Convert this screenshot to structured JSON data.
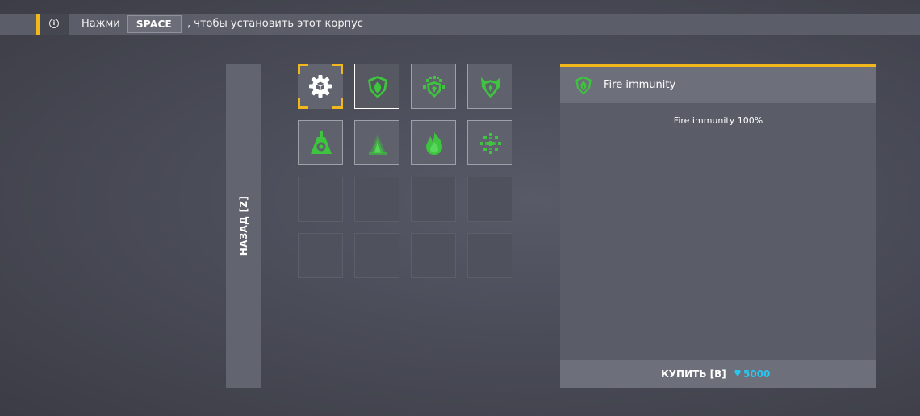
{
  "hint": {
    "prefix": "Нажми",
    "key": "SPACE",
    "suffix": ", чтобы установить этот корпус"
  },
  "back_button": {
    "label": "НАЗАД [Z]"
  },
  "grid": {
    "slots": [
      {
        "state": "selected",
        "icon": "gear-icon"
      },
      {
        "state": "hover",
        "icon": "shield-flame-icon"
      },
      {
        "state": "filled",
        "icon": "shield-snowflake-icon"
      },
      {
        "state": "filled",
        "icon": "shield-horns-icon"
      },
      {
        "state": "filled",
        "icon": "mine-icon"
      },
      {
        "state": "filled",
        "icon": "tesla-icon"
      },
      {
        "state": "filled",
        "icon": "flame-icon"
      },
      {
        "state": "filled",
        "icon": "snowflake-icon"
      },
      {
        "state": "empty"
      },
      {
        "state": "empty"
      },
      {
        "state": "empty"
      },
      {
        "state": "empty"
      },
      {
        "state": "empty"
      },
      {
        "state": "empty"
      },
      {
        "state": "empty"
      },
      {
        "state": "empty"
      }
    ]
  },
  "panel": {
    "title": "Fire immunity",
    "description": "Fire immunity 100%",
    "buy_label": "КУПИТЬ [B]",
    "price": "5000",
    "header_icon": "shield-flame-icon"
  },
  "colors": {
    "accent": "#f2b71c",
    "green": "#3ec43e",
    "crystal": "#29c7f0"
  }
}
